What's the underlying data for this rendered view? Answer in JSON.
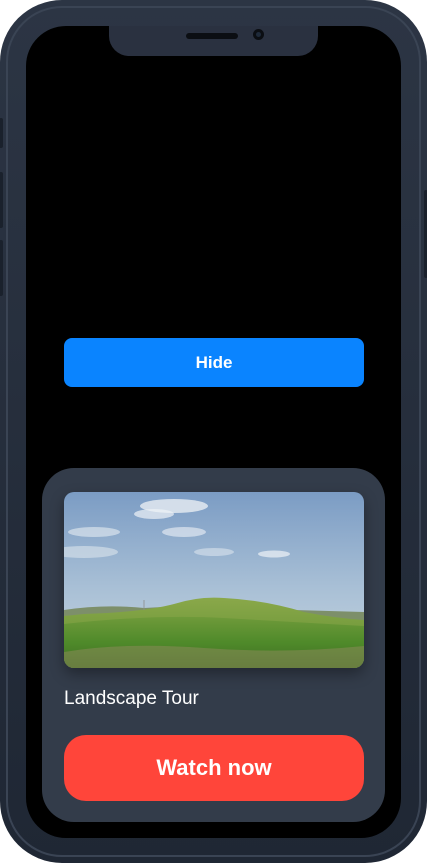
{
  "screen": {
    "hide_button_label": "Hide"
  },
  "card": {
    "image_subject": "green hill under blue sky landscape",
    "title": "Landscape Tour",
    "watch_button_label": "Watch now"
  },
  "colors": {
    "screen_background": "#000000",
    "hide_button": "#0a84ff",
    "sheet_background": "#333c4a",
    "watch_button": "#ff453a",
    "device_frame": "#2c3544"
  }
}
